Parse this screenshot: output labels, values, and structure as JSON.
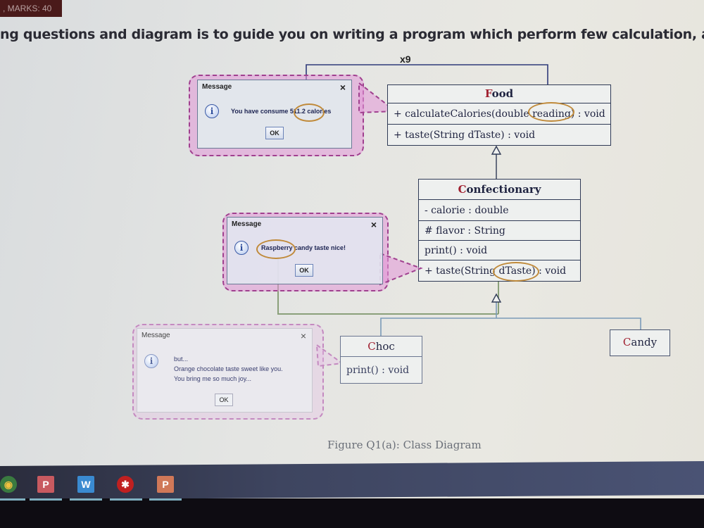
{
  "header": {
    "marks_label": ", MARKS: 40",
    "instruction": "ng questions and diagram is to guide you on writing a program which perform few calculation, and generate"
  },
  "diagram": {
    "multiplicity": "x9",
    "caption": "Figure Q1(a): Class Diagram",
    "classes": {
      "food": {
        "name_initial": "F",
        "name_rest": "ood",
        "methods": [
          "+ calculateCalories(double reading) : void",
          "+ taste(String dTaste) : void"
        ]
      },
      "confectionary": {
        "name_initial": "C",
        "name_rest": "onfectionary",
        "attributes": [
          "- calorie : double",
          "# flavor : String"
        ],
        "methods": [
          "print() : void",
          "+ taste(String dTaste) : void"
        ]
      },
      "choc": {
        "name_initial": "C",
        "name_rest": "hoc",
        "methods": [
          "print() : void"
        ]
      },
      "candy": {
        "name_initial": "C",
        "name_rest": "andy"
      }
    },
    "highlights": [
      "reading",
      "dTaste",
      "511.2",
      "Raspberry"
    ]
  },
  "dialogs": [
    {
      "title": "Message",
      "close_label": "×",
      "icon": "info-icon",
      "lines": [
        "You have consume 511.2 calories"
      ],
      "ok_label": "OK"
    },
    {
      "title": "Message",
      "close_label": "×",
      "icon": "info-icon",
      "lines": [
        "Raspberry candy taste nice!"
      ],
      "ok_label": "OK"
    },
    {
      "title": "Message",
      "close_label": "×",
      "icon": "info-icon",
      "lines": [
        "but...",
        "Orange chocolate taste sweet like you.",
        "You bring me so much joy..."
      ],
      "ok_label": "OK"
    }
  ],
  "taskbar": {
    "apps": [
      {
        "name": "chrome",
        "glyph": "◉",
        "color": "#d8a030"
      },
      {
        "name": "app-p",
        "glyph": "P",
        "color": "#c85a60"
      },
      {
        "name": "word",
        "glyph": "W",
        "color": "#3a8ad0"
      },
      {
        "name": "app-red",
        "glyph": "✱",
        "color": "#c02020"
      },
      {
        "name": "powerpoint",
        "glyph": "P",
        "color": "#d07858"
      }
    ]
  }
}
